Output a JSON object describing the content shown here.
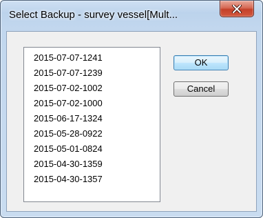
{
  "window": {
    "title": "Select Backup - survey vessel[Mult...",
    "close_icon": "close-icon"
  },
  "backup_list": {
    "items": [
      "2015-07-07-1241",
      "2015-07-07-1239",
      "2015-07-02-1002",
      "2015-07-02-1000",
      "2015-06-17-1324",
      "2015-05-28-0922",
      "2015-05-01-0824",
      "2015-04-30-1359",
      "2015-04-30-1357"
    ]
  },
  "buttons": {
    "ok_label": "OK",
    "cancel_label": "Cancel"
  },
  "colors": {
    "close_button": "#c7432b",
    "default_button_border": "#3c7fb1"
  }
}
